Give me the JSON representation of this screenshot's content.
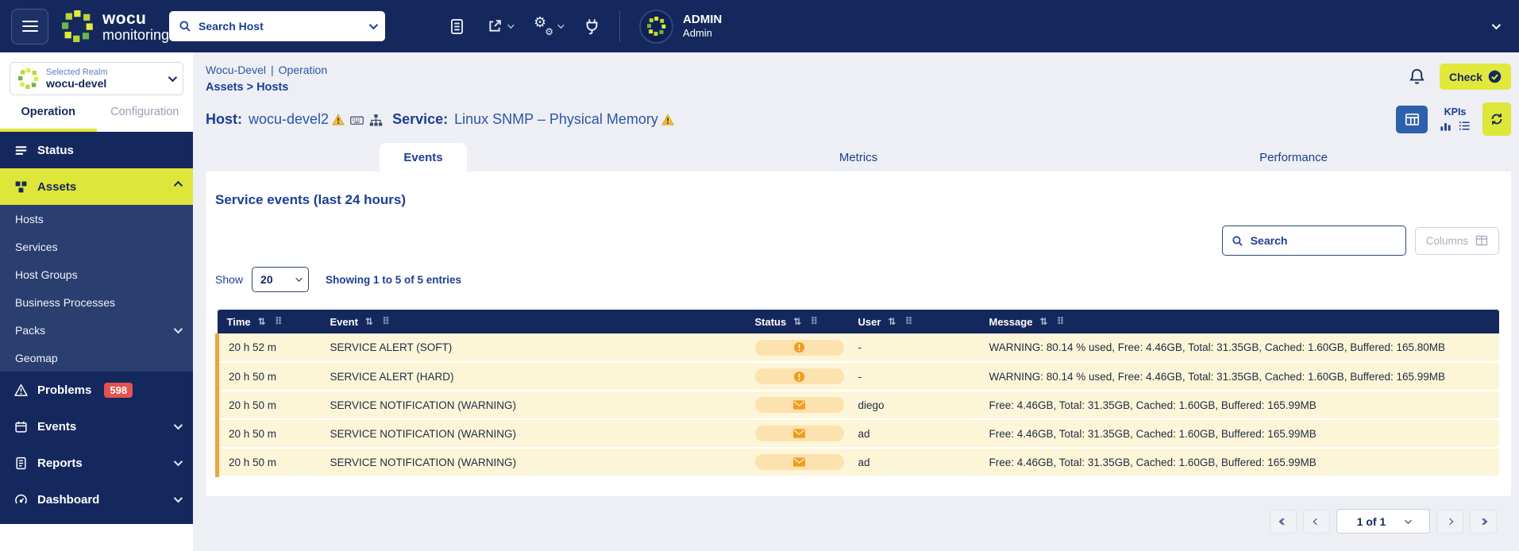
{
  "topbar": {
    "logo_line1": "wocu",
    "logo_line2": "monitoring",
    "search_placeholder": "Search Host",
    "user_name": "ADMIN",
    "user_role": "Admin"
  },
  "sidebar": {
    "realm_label": "Selected Realm",
    "realm_value": "wocu-devel",
    "tabs": [
      {
        "label": "Operation"
      },
      {
        "label": "Configuration"
      }
    ],
    "nav": [
      {
        "label": "Status"
      },
      {
        "label": "Assets"
      },
      {
        "label": "Problems",
        "badge": "598"
      },
      {
        "label": "Events"
      },
      {
        "label": "Reports"
      },
      {
        "label": "Dashboard"
      }
    ],
    "assets_submenu": [
      "Hosts",
      "Services",
      "Host Groups",
      "Business Processes",
      "Packs",
      "Geomap"
    ]
  },
  "breadcrumb": {
    "realm": "Wocu-Devel",
    "separator": "|",
    "section": "Operation",
    "path": "Assets > Hosts"
  },
  "header": {
    "check_button": "Check",
    "host_label": "Host:",
    "host_value": "wocu-devel2",
    "service_label": "Service:",
    "service_value": "Linux SNMP – Physical Memory",
    "kpis_label": "KPIs"
  },
  "content_tabs": [
    "Events",
    "Metrics",
    "Performance"
  ],
  "panel": {
    "title": "Service events (last 24 hours)",
    "search_placeholder": "Search",
    "columns_button": "Columns",
    "show_label": "Show",
    "page_size": "20",
    "showing_text": "Showing 1 to 5 of 5 entries"
  },
  "table": {
    "headers": [
      "Time",
      "Event",
      "Status",
      "User",
      "Message"
    ],
    "rows": [
      {
        "time": "20 h 52 m",
        "event": "SERVICE ALERT (SOFT)",
        "status_icon": "exclamation-circle-icon",
        "user": "-",
        "message": "WARNING: 80.14 % used, Free: 4.46GB, Total: 31.35GB, Cached: 1.60GB, Buffered: 165.80MB"
      },
      {
        "time": "20 h 50 m",
        "event": "SERVICE ALERT (HARD)",
        "status_icon": "exclamation-circle-icon",
        "user": "-",
        "message": "WARNING: 80.14 % used, Free: 4.46GB, Total: 31.35GB, Cached: 1.60GB, Buffered: 165.99MB"
      },
      {
        "time": "20 h 50 m",
        "event": "SERVICE NOTIFICATION (WARNING)",
        "status_icon": "envelope-icon",
        "user": "diego",
        "message": "Free: 4.46GB, Total: 31.35GB, Cached: 1.60GB, Buffered: 165.99MB"
      },
      {
        "time": "20 h 50 m",
        "event": "SERVICE NOTIFICATION (WARNING)",
        "status_icon": "envelope-icon",
        "user": "ad",
        "message": "Free: 4.46GB, Total: 31.35GB, Cached: 1.60GB, Buffered: 165.99MB"
      },
      {
        "time": "20 h 50 m",
        "event": "SERVICE NOTIFICATION (WARNING)",
        "status_icon": "envelope-icon",
        "user": "ad",
        "message": "Free: 4.46GB, Total: 31.35GB, Cached: 1.60GB, Buffered: 165.99MB"
      }
    ]
  },
  "pagination": {
    "page_text": "1 of 1"
  },
  "icons": {
    "hamburger-menu": "bars",
    "search": "magnifier",
    "chevron": "angle",
    "warning": "triangle-exclamation",
    "exclamation-circle": "!",
    "envelope": "mail",
    "refresh": "arrows-rotate",
    "bell": "bell",
    "check-circle": "check",
    "sort": "up-down-arrows",
    "drag-handle": "dots-grip"
  },
  "colors": {
    "navy": "#15285d",
    "accent_yellow": "#dfe63a",
    "badge_red": "#e3544e",
    "row_yellow": "#fdf5d8",
    "row_border_orange": "#eca53b",
    "status_badge_bg": "#fbe2ae",
    "status_icon_orange": "#ef9d20",
    "link_blue": "#2b55a7",
    "heading_blue": "#1c3e93",
    "primary_button_blue": "#2e61ad"
  }
}
